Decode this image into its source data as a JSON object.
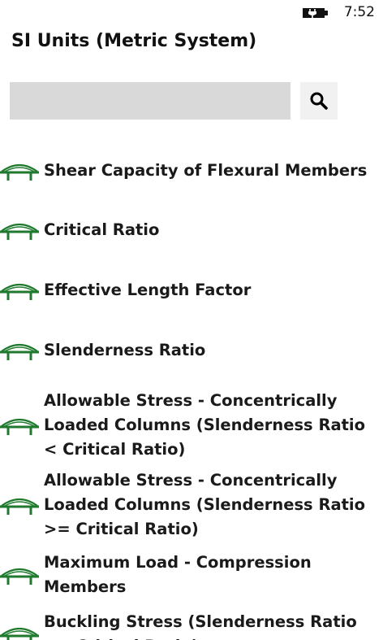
{
  "status": {
    "time": "7:52",
    "battery_icon": "battery-charging-icon"
  },
  "header": {
    "title": "SI Units (Metric System)"
  },
  "search": {
    "value": "",
    "placeholder": "",
    "button_icon": "search-icon"
  },
  "theme": {
    "icon_color": "#1f7a2e",
    "search_field_color": "#d9d9d9",
    "search_button_color": "#f1f1f1"
  },
  "topics": [
    {
      "label": "Shear Capacity of Flexural Members",
      "icon": "bridge-icon"
    },
    {
      "label": "Critical Ratio",
      "icon": "bridge-icon"
    },
    {
      "label": "Effective Length Factor",
      "icon": "bridge-icon"
    },
    {
      "label": "Slenderness Ratio",
      "icon": "bridge-icon"
    },
    {
      "label": "Allowable Stress - Concentrically Loaded Columns (Slenderness Ratio < Critical Ratio)",
      "icon": "bridge-icon"
    },
    {
      "label": "Allowable Stress - Concentrically Loaded Columns (Slenderness Ratio >= Critical Ratio)",
      "icon": "bridge-icon"
    },
    {
      "label": "Maximum Load - Compression Members",
      "icon": "bridge-icon"
    },
    {
      "label": "Buckling Stress (Slenderness Ratio <= Critical Ratio)",
      "icon": "bridge-icon"
    }
  ]
}
